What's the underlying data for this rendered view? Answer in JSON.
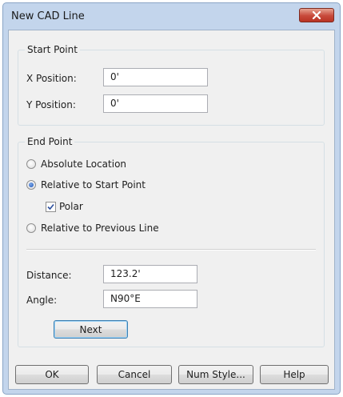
{
  "window": {
    "title": "New CAD Line",
    "close_icon": "close-icon",
    "close_color": "#c7493a"
  },
  "start_point": {
    "label": "Start Point",
    "x_label": "X Position:",
    "x_value": "0'",
    "y_label": "Y Position:",
    "y_value": "0'"
  },
  "end_point": {
    "label": "End Point",
    "options": {
      "absolute": "Absolute Location",
      "relative_start": "Relative to Start Point",
      "polar": "Polar",
      "relative_previous": "Relative to Previous Line"
    },
    "selected": "Relative to Start Point",
    "polar_checked": true,
    "distance_label": "Distance:",
    "distance_value": "123.2'",
    "angle_label": "Angle:",
    "angle_value": "N90°E",
    "next_label": "Next"
  },
  "buttons": {
    "ok": "OK",
    "cancel": "Cancel",
    "num_style": "Num Style...",
    "help": "Help"
  }
}
